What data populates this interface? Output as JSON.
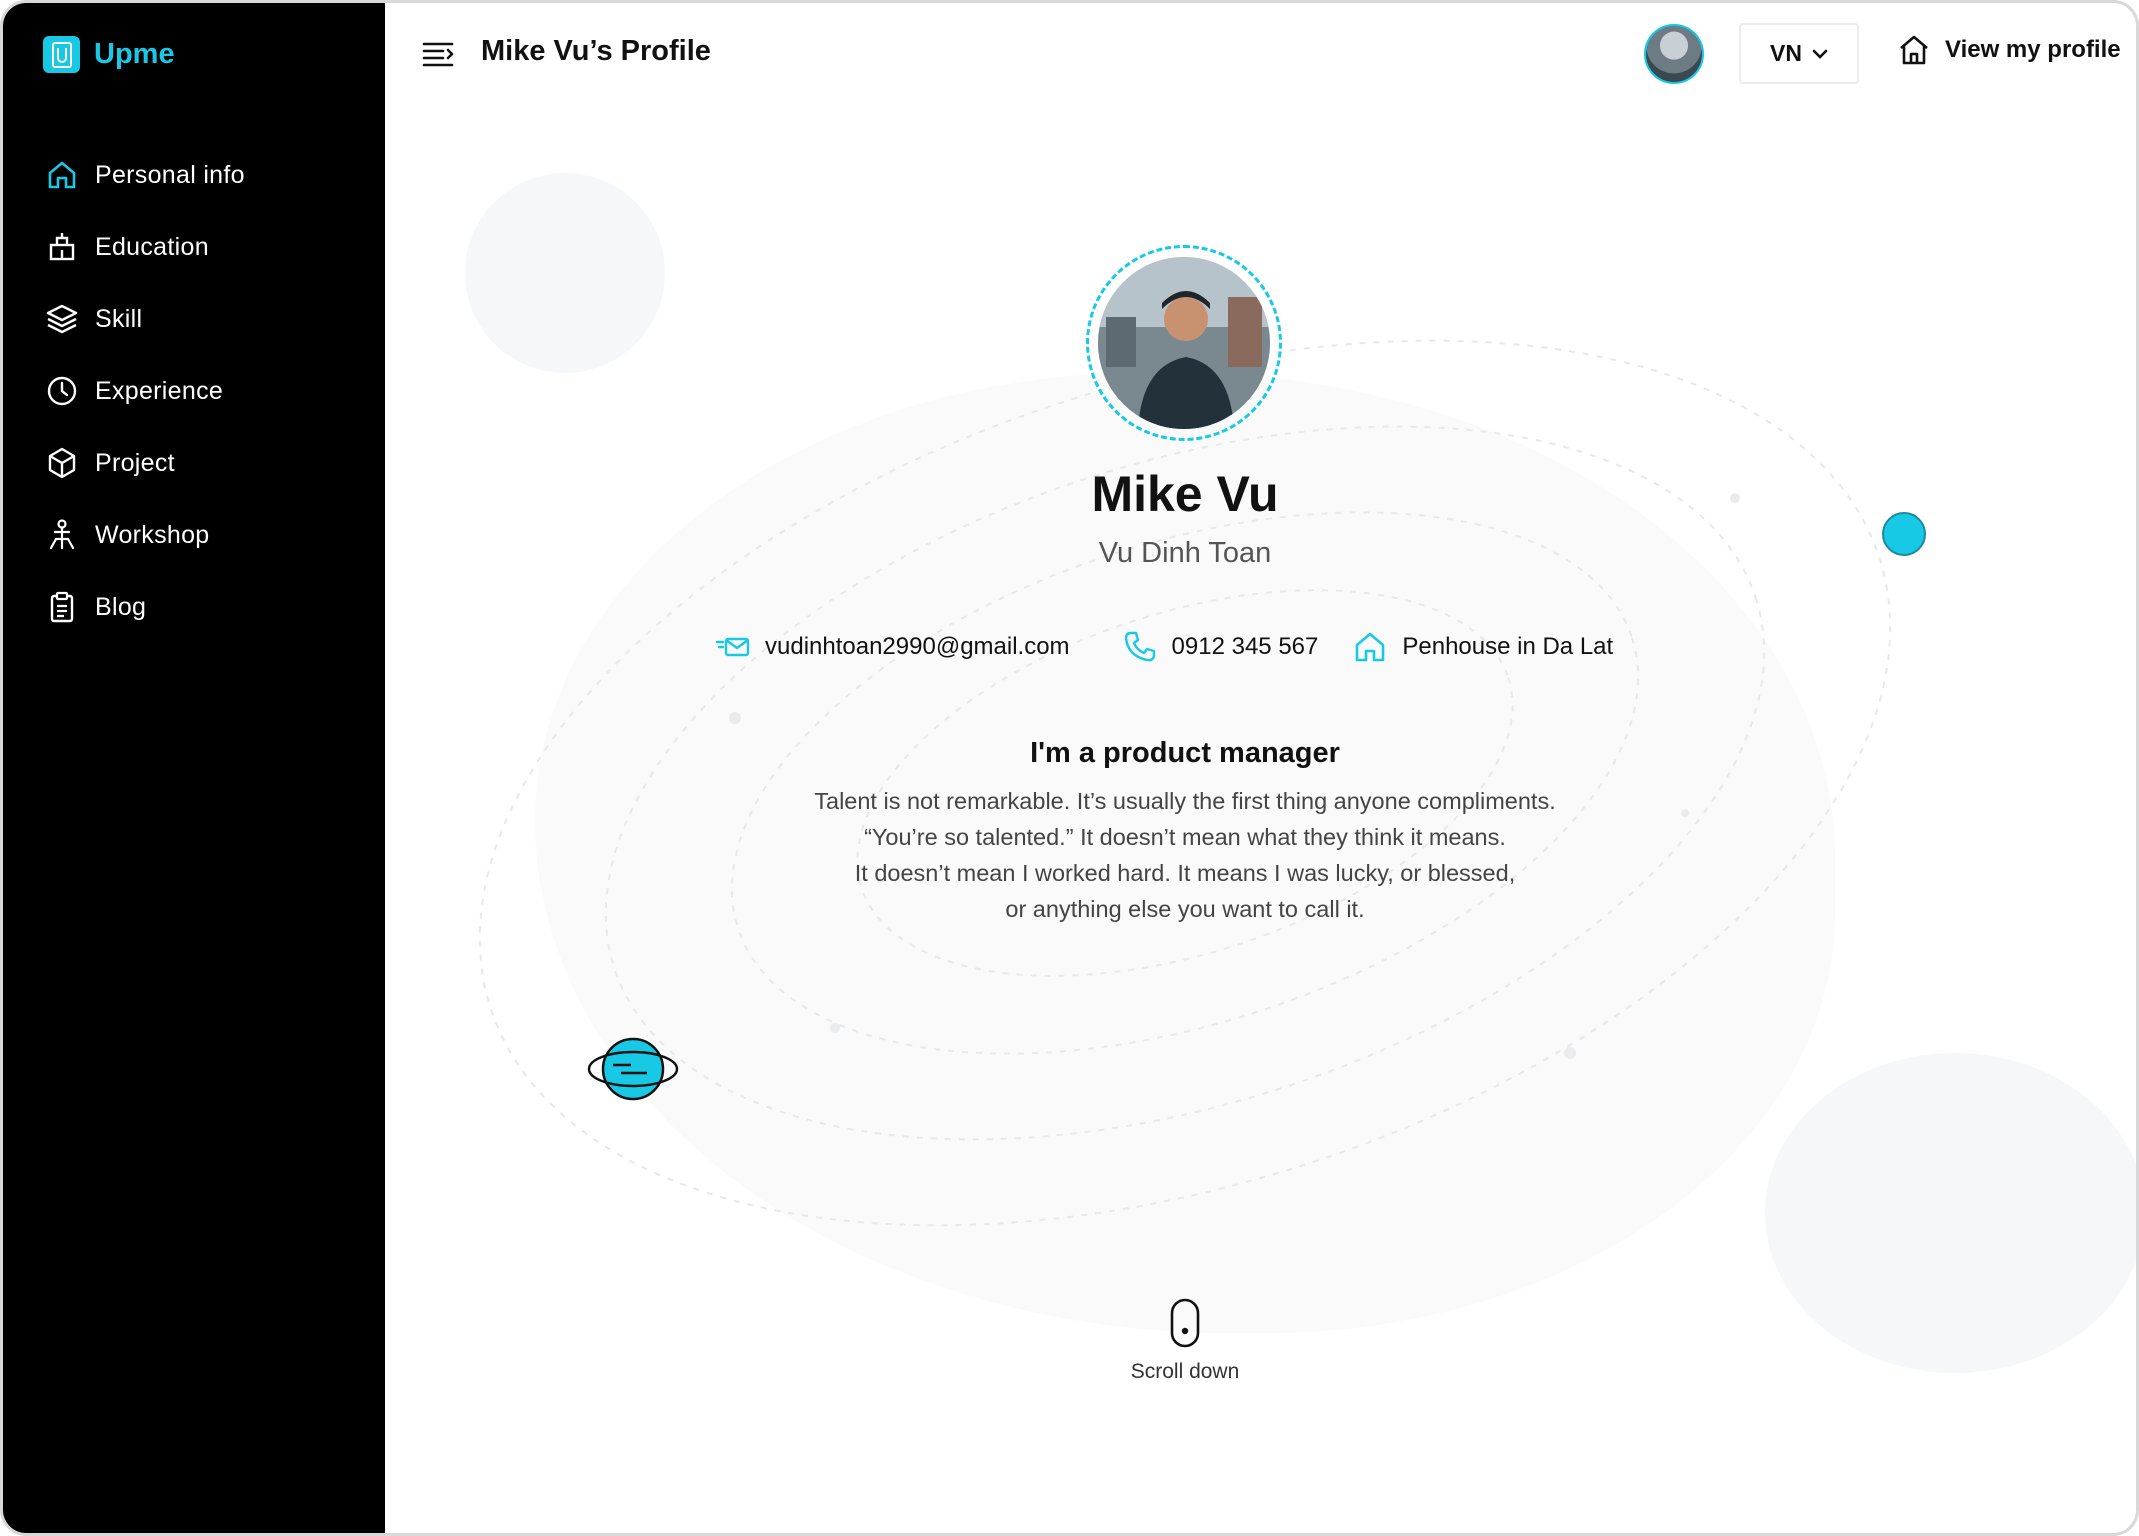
{
  "brand": {
    "name": "Upme",
    "accent": "#18c9e6"
  },
  "sidebar": {
    "items": [
      {
        "label": "Personal info",
        "icon": "home-icon"
      },
      {
        "label": "Education",
        "icon": "education-icon"
      },
      {
        "label": "Skill",
        "icon": "layers-icon"
      },
      {
        "label": "Experience",
        "icon": "clock-icon"
      },
      {
        "label": "Project",
        "icon": "cube-icon"
      },
      {
        "label": "Workshop",
        "icon": "workshop-icon"
      },
      {
        "label": "Blog",
        "icon": "clipboard-icon"
      }
    ]
  },
  "header": {
    "title": "Mike Vu’s Profile",
    "language": "VN",
    "view_profile": "View my profile"
  },
  "profile": {
    "name": "Mike Vu",
    "full_name": "Vu Dinh Toan",
    "email": "vudinhtoan2990@gmail.com",
    "phone": "0912 345 567",
    "address": "Penhouse in Da Lat",
    "headline": "I'm a product manager",
    "bio_lines": [
      "Talent is not remarkable. It’s usually the first thing anyone compliments.",
      "“You’re so talented.” It doesn’t mean what they think it means.",
      "It doesn’t mean I worked hard. It means I was lucky, or blessed,",
      "or anything else you want to call it."
    ]
  },
  "scroll": {
    "label": "Scroll down"
  }
}
